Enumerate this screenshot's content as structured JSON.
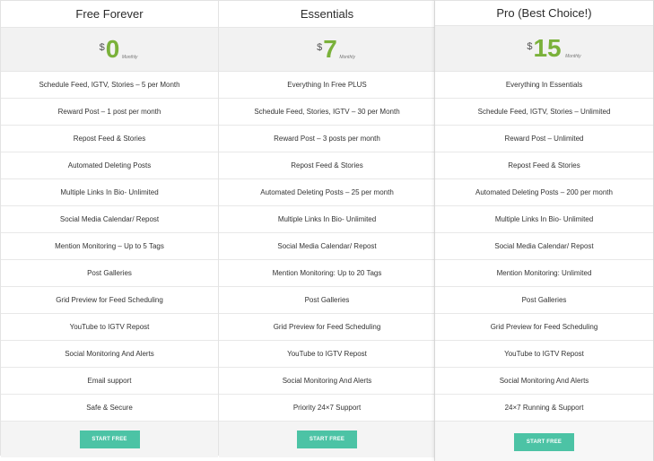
{
  "plans": [
    {
      "name": "Free Forever",
      "currency": "$",
      "amount": "0",
      "period": "Monthly",
      "features": [
        "Schedule Feed, IGTV, Stories – 5 per Month",
        "Reward Post – 1 post per month",
        "Repost Feed & Stories",
        "Automated Deleting Posts",
        "Multiple Links In Bio- Unlimited",
        "Social Media Calendar/ Repost",
        "Mention Monitoring – Up to 5 Tags",
        "Post Galleries",
        "Grid Preview for Feed Scheduling",
        "YouTube to IGTV Repost",
        "Social Monitoring And Alerts",
        "Email support",
        "Safe & Secure"
      ],
      "button": "START FREE"
    },
    {
      "name": "Essentials",
      "currency": "$",
      "amount": "7",
      "period": "Monthly",
      "features": [
        "Everything In Free PLUS",
        "Schedule Feed, Stories, IGTV – 30 per Month",
        "Reward Post – 3 posts per month",
        "Repost Feed & Stories",
        "Automated Deleting Posts – 25 per month",
        "Multiple Links In Bio- Unlimited",
        "Social Media Calendar/ Repost",
        "Mention Monitoring: Up to 20 Tags",
        "Post Galleries",
        "Grid Preview for Feed Scheduling",
        "YouTube to IGTV Repost",
        "Social Monitoring And Alerts",
        "Priority 24×7 Support"
      ],
      "button": "START FREE"
    },
    {
      "name": "Pro (Best Choice!)",
      "currency": "$",
      "amount": "15",
      "period": "Monthly",
      "features": [
        "Everything In Essentials",
        "Schedule Feed, IGTV, Stories – Unlimited",
        "Reward Post – Unlimited",
        "Repost Feed & Stories",
        "Automated Deleting Posts – 200 per month",
        "Multiple Links In Bio- Unlimited",
        "Social Media Calendar/ Repost",
        "Mention Monitoring: Unlimited",
        "Post Galleries",
        "Grid Preview for Feed Scheduling",
        "YouTube to IGTV Repost",
        "Social Monitoring And Alerts",
        "24×7 Running & Support"
      ],
      "button": "START FREE"
    }
  ],
  "colors": {
    "price_green": "#7ab13a",
    "button_teal": "#4cc3a5",
    "price_band": "#f2f2f2"
  }
}
